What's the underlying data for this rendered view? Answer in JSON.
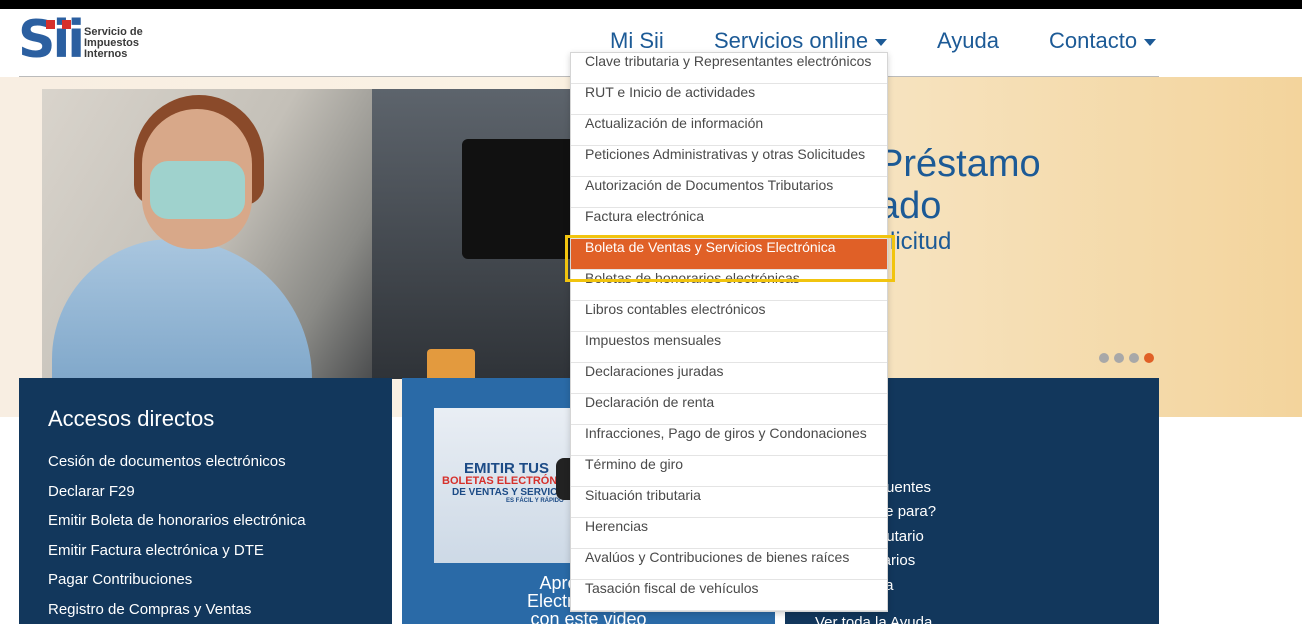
{
  "logo": {
    "mark": "Sii",
    "text": [
      "Servicio de",
      "Impuestos",
      "Internos"
    ],
    "brand_color": "#2b5fa0",
    "accent_color": "#d6302b"
  },
  "nav": {
    "mi_sii": "Mi Sii",
    "servicios": "Servicios online",
    "ayuda": "Ayuda",
    "contacto": "Contacto"
  },
  "hero": {
    "title_line1": "Préstamo",
    "title_line2": "ado",
    "subtitle": "licitud",
    "slides_total": 4,
    "slide_active": 4
  },
  "dropdown": {
    "items": [
      "Clave tributaria y Representantes electrónicos",
      "RUT e Inicio de actividades",
      "Actualización de información",
      "Peticiones Administrativas y otras Solicitudes",
      "Autorización de Documentos Tributarios",
      "Factura electrónica",
      "Boleta de Ventas y Servicios Electrónica",
      "Boletas de honorarios electrónicas",
      "Libros contables electrónicos",
      "Impuestos mensuales",
      "Declaraciones juradas",
      "Declaración de renta",
      "Infracciones, Pago de giros y Condonaciones",
      "Término de giro",
      "Situación tributaria",
      "Herencias",
      "Avalúos y Contribuciones de bienes raíces",
      "Tasación fiscal de vehículos"
    ],
    "active_index": 6,
    "active_color": "#e06027",
    "highlight_color": "#f1c40f"
  },
  "accesos": {
    "title": "Accesos directos",
    "items": [
      "Cesión de documentos electrónicos",
      "Declarar F29",
      "Emitir Boleta de honorarios electrónica",
      "Emitir Factura electrónica y DTE",
      "Pagar Contribuciones",
      "Registro de Compras y Ventas"
    ]
  },
  "promo": {
    "line1": "EMITIR TUS",
    "line2": "BOLETAS ELECTRÓNICA",
    "line3": "DE VENTAS Y SERVICIOS",
    "line4": "ES FÁCIL Y RÁPIDO",
    "caption_line1": "Aprende a e",
    "caption_line2": "Electrónicas de",
    "caption_line3": "con este video"
  },
  "ayuda_panel": {
    "items": [
      "s",
      "frecuentes",
      "hace para?",
      "Tributario",
      "norarios",
      "yuda"
    ],
    "footer": "Ver toda la Ayuda"
  }
}
